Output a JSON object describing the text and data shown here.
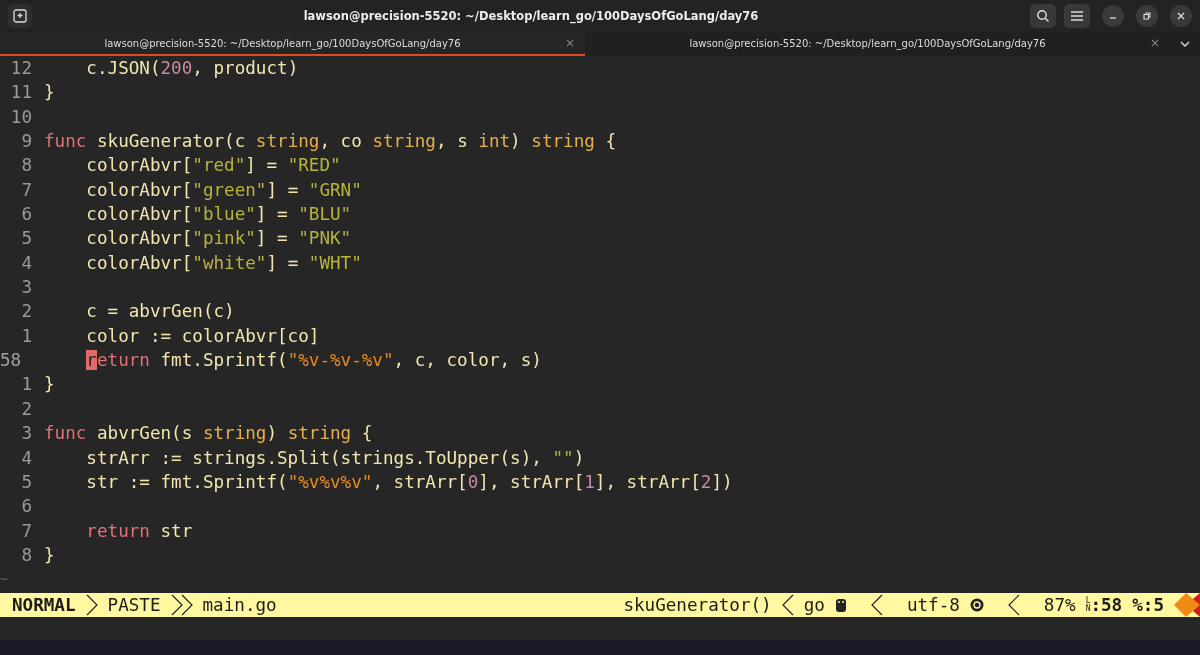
{
  "window": {
    "title": "lawson@precision-5520: ~/Desktop/learn_go/100DaysOfGoLang/day76"
  },
  "tabs": [
    {
      "label": "lawson@precision-5520: ~/Desktop/learn_go/100DaysOfGoLang/day76",
      "close": "×",
      "selected": true
    },
    {
      "label": "lawson@precision-5520: ~/Desktop/learn_go/100DaysOfGoLang/day76",
      "close": "×",
      "selected": false
    }
  ],
  "editor": {
    "lines": [
      {
        "number": "12",
        "current": false,
        "indent": true,
        "tokens": [
          {
            "kind": "plain",
            "text": "c.JSON("
          },
          {
            "kind": "number",
            "text": "200"
          },
          {
            "kind": "plain",
            "text": ", product)"
          }
        ]
      },
      {
        "number": "11",
        "current": false,
        "indent": false,
        "tokens": [
          {
            "kind": "plain",
            "text": "}"
          }
        ]
      },
      {
        "number": "10",
        "current": false
      },
      {
        "number": "9",
        "current": false,
        "indent": false,
        "tokens": [
          {
            "kind": "keyword",
            "text": "func"
          },
          {
            "kind": "plain",
            "text": " skuGenerator(c "
          },
          {
            "kind": "type",
            "text": "string"
          },
          {
            "kind": "plain",
            "text": ", co "
          },
          {
            "kind": "type",
            "text": "string"
          },
          {
            "kind": "plain",
            "text": ", s "
          },
          {
            "kind": "type",
            "text": "int"
          },
          {
            "kind": "plain",
            "text": ") "
          },
          {
            "kind": "type",
            "text": "string"
          },
          {
            "kind": "plain",
            "text": " {"
          }
        ]
      },
      {
        "number": "8",
        "current": false,
        "indent": true,
        "tokens": [
          {
            "kind": "plain",
            "text": "colorAbvr["
          },
          {
            "kind": "string",
            "text": "\"red\""
          },
          {
            "kind": "plain",
            "text": "] = "
          },
          {
            "kind": "string",
            "text": "\"RED\""
          }
        ]
      },
      {
        "number": "7",
        "current": false,
        "indent": true,
        "tokens": [
          {
            "kind": "plain",
            "text": "colorAbvr["
          },
          {
            "kind": "string",
            "text": "\"green\""
          },
          {
            "kind": "plain",
            "text": "] = "
          },
          {
            "kind": "string",
            "text": "\"GRN\""
          }
        ]
      },
      {
        "number": "6",
        "current": false,
        "indent": true,
        "tokens": [
          {
            "kind": "plain",
            "text": "colorAbvr["
          },
          {
            "kind": "string",
            "text": "\"blue\""
          },
          {
            "kind": "plain",
            "text": "] = "
          },
          {
            "kind": "string",
            "text": "\"BLU\""
          }
        ]
      },
      {
        "number": "5",
        "current": false,
        "indent": true,
        "tokens": [
          {
            "kind": "plain",
            "text": "colorAbvr["
          },
          {
            "kind": "string",
            "text": "\"pink\""
          },
          {
            "kind": "plain",
            "text": "] = "
          },
          {
            "kind": "string",
            "text": "\"PNK\""
          }
        ]
      },
      {
        "number": "4",
        "current": false,
        "indent": true,
        "tokens": [
          {
            "kind": "plain",
            "text": "colorAbvr["
          },
          {
            "kind": "string",
            "text": "\"white\""
          },
          {
            "kind": "plain",
            "text": "] = "
          },
          {
            "kind": "string",
            "text": "\"WHT\""
          }
        ]
      },
      {
        "number": "3",
        "current": false
      },
      {
        "number": "2",
        "current": false,
        "indent": true,
        "tokens": [
          {
            "kind": "plain",
            "text": "c = abvrGen(c)"
          }
        ]
      },
      {
        "number": "1",
        "current": false,
        "indent": true,
        "tokens": [
          {
            "kind": "plain",
            "text": "color := colorAbvr[co]"
          }
        ]
      },
      {
        "number": "58",
        "current": true,
        "indent": true,
        "tokens": [
          {
            "kind": "cursor",
            "text": "r"
          },
          {
            "kind": "keyword",
            "text": "eturn"
          },
          {
            "kind": "plain",
            "text": " fmt.Sprintf("
          },
          {
            "kind": "format",
            "text": "\"%v-%v-%v\""
          },
          {
            "kind": "plain",
            "text": ", c, color, s)"
          }
        ]
      },
      {
        "number": "1",
        "current": false,
        "indent": false,
        "tokens": [
          {
            "kind": "plain",
            "text": "}"
          }
        ]
      },
      {
        "number": "2",
        "current": false
      },
      {
        "number": "3",
        "current": false,
        "indent": false,
        "tokens": [
          {
            "kind": "keyword",
            "text": "func"
          },
          {
            "kind": "plain",
            "text": " abvrGen(s "
          },
          {
            "kind": "type",
            "text": "string"
          },
          {
            "kind": "plain",
            "text": ") "
          },
          {
            "kind": "type",
            "text": "string"
          },
          {
            "kind": "plain",
            "text": " {"
          }
        ]
      },
      {
        "number": "4",
        "current": false,
        "indent": true,
        "tokens": [
          {
            "kind": "plain",
            "text": "strArr := strings.Split(strings.ToUpper(s), "
          },
          {
            "kind": "string",
            "text": "\"\""
          },
          {
            "kind": "plain",
            "text": ")"
          }
        ]
      },
      {
        "number": "5",
        "current": false,
        "indent": true,
        "tokens": [
          {
            "kind": "plain",
            "text": "str := fmt.Sprintf("
          },
          {
            "kind": "format",
            "text": "\"%v%v%v\""
          },
          {
            "kind": "plain",
            "text": ", strArr["
          },
          {
            "kind": "number",
            "text": "0"
          },
          {
            "kind": "plain",
            "text": "], strArr["
          },
          {
            "kind": "number",
            "text": "1"
          },
          {
            "kind": "plain",
            "text": "], strArr["
          },
          {
            "kind": "number",
            "text": "2"
          },
          {
            "kind": "plain",
            "text": "])"
          }
        ]
      },
      {
        "number": "6",
        "current": false
      },
      {
        "number": "7",
        "current": false,
        "indent": true,
        "tokens": [
          {
            "kind": "keyword",
            "text": "return"
          },
          {
            "kind": "plain",
            "text": " str"
          }
        ]
      },
      {
        "number": "8",
        "current": false,
        "indent": false,
        "tokens": [
          {
            "kind": "plain",
            "text": "}"
          }
        ]
      }
    ],
    "filler": "~"
  },
  "status_bar": {
    "mode": "NORMAL",
    "paste": "PASTE",
    "file": "main.go",
    "function": "skuGenerator()",
    "filetype": "go",
    "encoding": "utf-8",
    "percent": "87%",
    "line_symbol": "LN",
    "line": ":58",
    "column": "%:5"
  }
}
